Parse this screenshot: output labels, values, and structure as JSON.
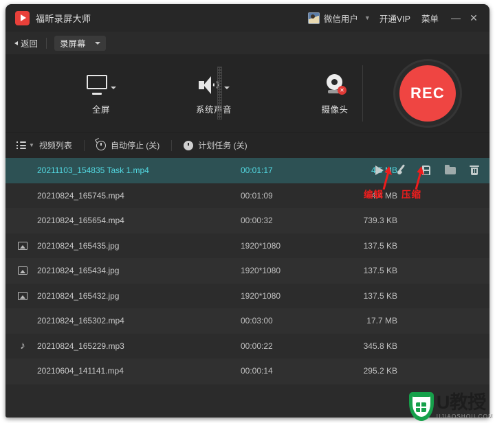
{
  "window": {
    "app_title": "福昕录屏大师",
    "logo_icon": "play-logo-icon"
  },
  "titlebar": {
    "avatar_icon": "avatar",
    "user_name": "微信用户",
    "chevron_icon": "chevron-down-icon",
    "vip_label": "开通VIP",
    "menu_label": "菜单",
    "minimize_glyph": "—",
    "close_glyph": "✕"
  },
  "modebar": {
    "back_label": "返回",
    "mode_value": "录屏幕",
    "caret_icon": "caret-down-icon"
  },
  "capture": {
    "items": [
      {
        "label": "全屏",
        "icon": "monitor-icon",
        "has_caret": true
      },
      {
        "label": "系统声音",
        "icon": "speaker-icon",
        "has_caret": true
      },
      {
        "label": "摄像头",
        "icon": "camera-icon",
        "has_caret": false,
        "badge": "✕"
      }
    ],
    "rec_label": "REC",
    "rec_color": "#ef4542"
  },
  "toolstrip": {
    "list_label": "视频列表",
    "list_icon": "list-icon",
    "autostop_label": "自动停止 (关)",
    "autostop_icon": "alarm-clock-icon",
    "schedule_label": "计划任务 (关)",
    "schedule_icon": "clock-icon"
  },
  "filelist": {
    "rows": [
      {
        "name": "20211103_154835 Task 1.mp4",
        "duration": "00:01:17",
        "size": "4.5 MB",
        "type_icon": "",
        "selected": true
      },
      {
        "name": "20210824_165745.mp4",
        "duration": "00:01:09",
        "size": "4.4 MB",
        "type_icon": "",
        "selected": false
      },
      {
        "name": "20210824_165654.mp4",
        "duration": "00:00:32",
        "size": "739.3 KB",
        "type_icon": "",
        "selected": false
      },
      {
        "name": "20210824_165435.jpg",
        "duration": "1920*1080",
        "size": "137.5 KB",
        "type_icon": "image-icon",
        "selected": false
      },
      {
        "name": "20210824_165434.jpg",
        "duration": "1920*1080",
        "size": "137.5 KB",
        "type_icon": "image-icon",
        "selected": false
      },
      {
        "name": "20210824_165432.jpg",
        "duration": "1920*1080",
        "size": "137.5 KB",
        "type_icon": "image-icon",
        "selected": false
      },
      {
        "name": "20210824_165302.mp4",
        "duration": "00:03:00",
        "size": "17.7 MB",
        "type_icon": "",
        "selected": false
      },
      {
        "name": "20210824_165229.mp3",
        "duration": "00:00:22",
        "size": "345.8 KB",
        "type_icon": "music-note-icon",
        "selected": false
      },
      {
        "name": "20210604_141141.mp4",
        "duration": "00:00:14",
        "size": "295.2 KB",
        "type_icon": "",
        "selected": false
      }
    ],
    "actions": [
      {
        "icon": "play-icon",
        "name": "play-button"
      },
      {
        "icon": "brush-icon",
        "name": "edit-button"
      },
      {
        "icon": "compress-icon",
        "name": "compress-button"
      },
      {
        "icon": "folder-icon",
        "name": "open-folder-button"
      },
      {
        "icon": "trash-icon",
        "name": "delete-button"
      }
    ],
    "selected_row_bg": "#2d5154",
    "selected_row_text": "#53d9e2"
  },
  "annotations": {
    "color": "#ee1d1d",
    "edit_label": "编辑",
    "compress_label": "压缩"
  },
  "watermark": {
    "title": "U教授",
    "subtitle": "UJIAOSHOU.COM",
    "shield_icon": "shield-logo-icon",
    "color": "#16a04a"
  }
}
